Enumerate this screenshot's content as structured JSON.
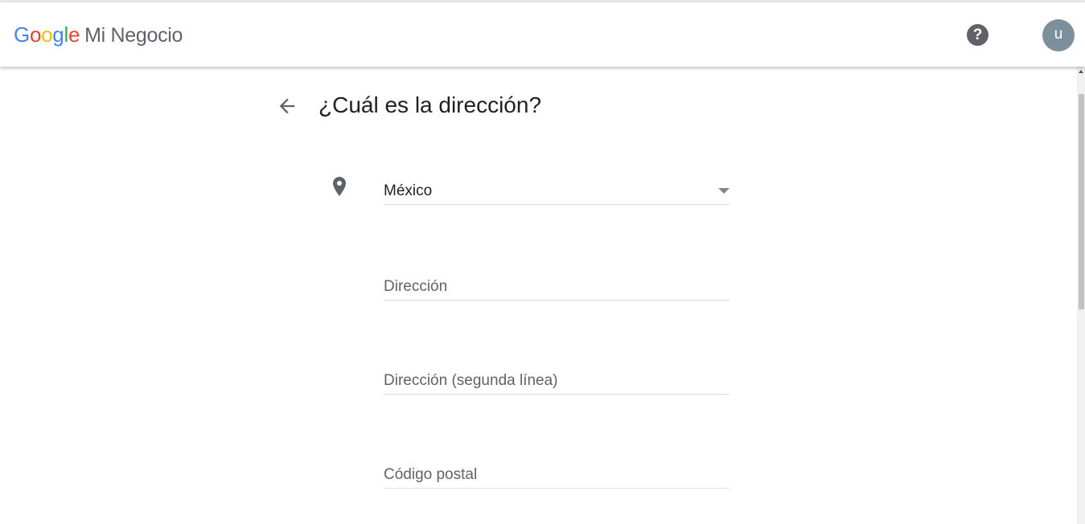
{
  "header": {
    "logo_word": "Google",
    "product_name": "Mi Negocio",
    "help_icon": "question-circle-icon",
    "avatar_initial": "u"
  },
  "main": {
    "back_icon": "arrow-left-icon",
    "title": "¿Cuál es la dirección?",
    "location_icon": "map-pin-icon",
    "country_select": {
      "value": "México"
    },
    "fields": [
      {
        "placeholder": "Dirección"
      },
      {
        "placeholder": "Dirección (segunda línea)"
      },
      {
        "placeholder": "Código postal"
      }
    ]
  },
  "colors": {
    "google_blue": "#4285F4",
    "google_red": "#EA4335",
    "google_yellow": "#FBBC05",
    "google_green": "#34A853",
    "icon_gray": "#5f6368",
    "avatar_bg": "#7d8f9a"
  }
}
